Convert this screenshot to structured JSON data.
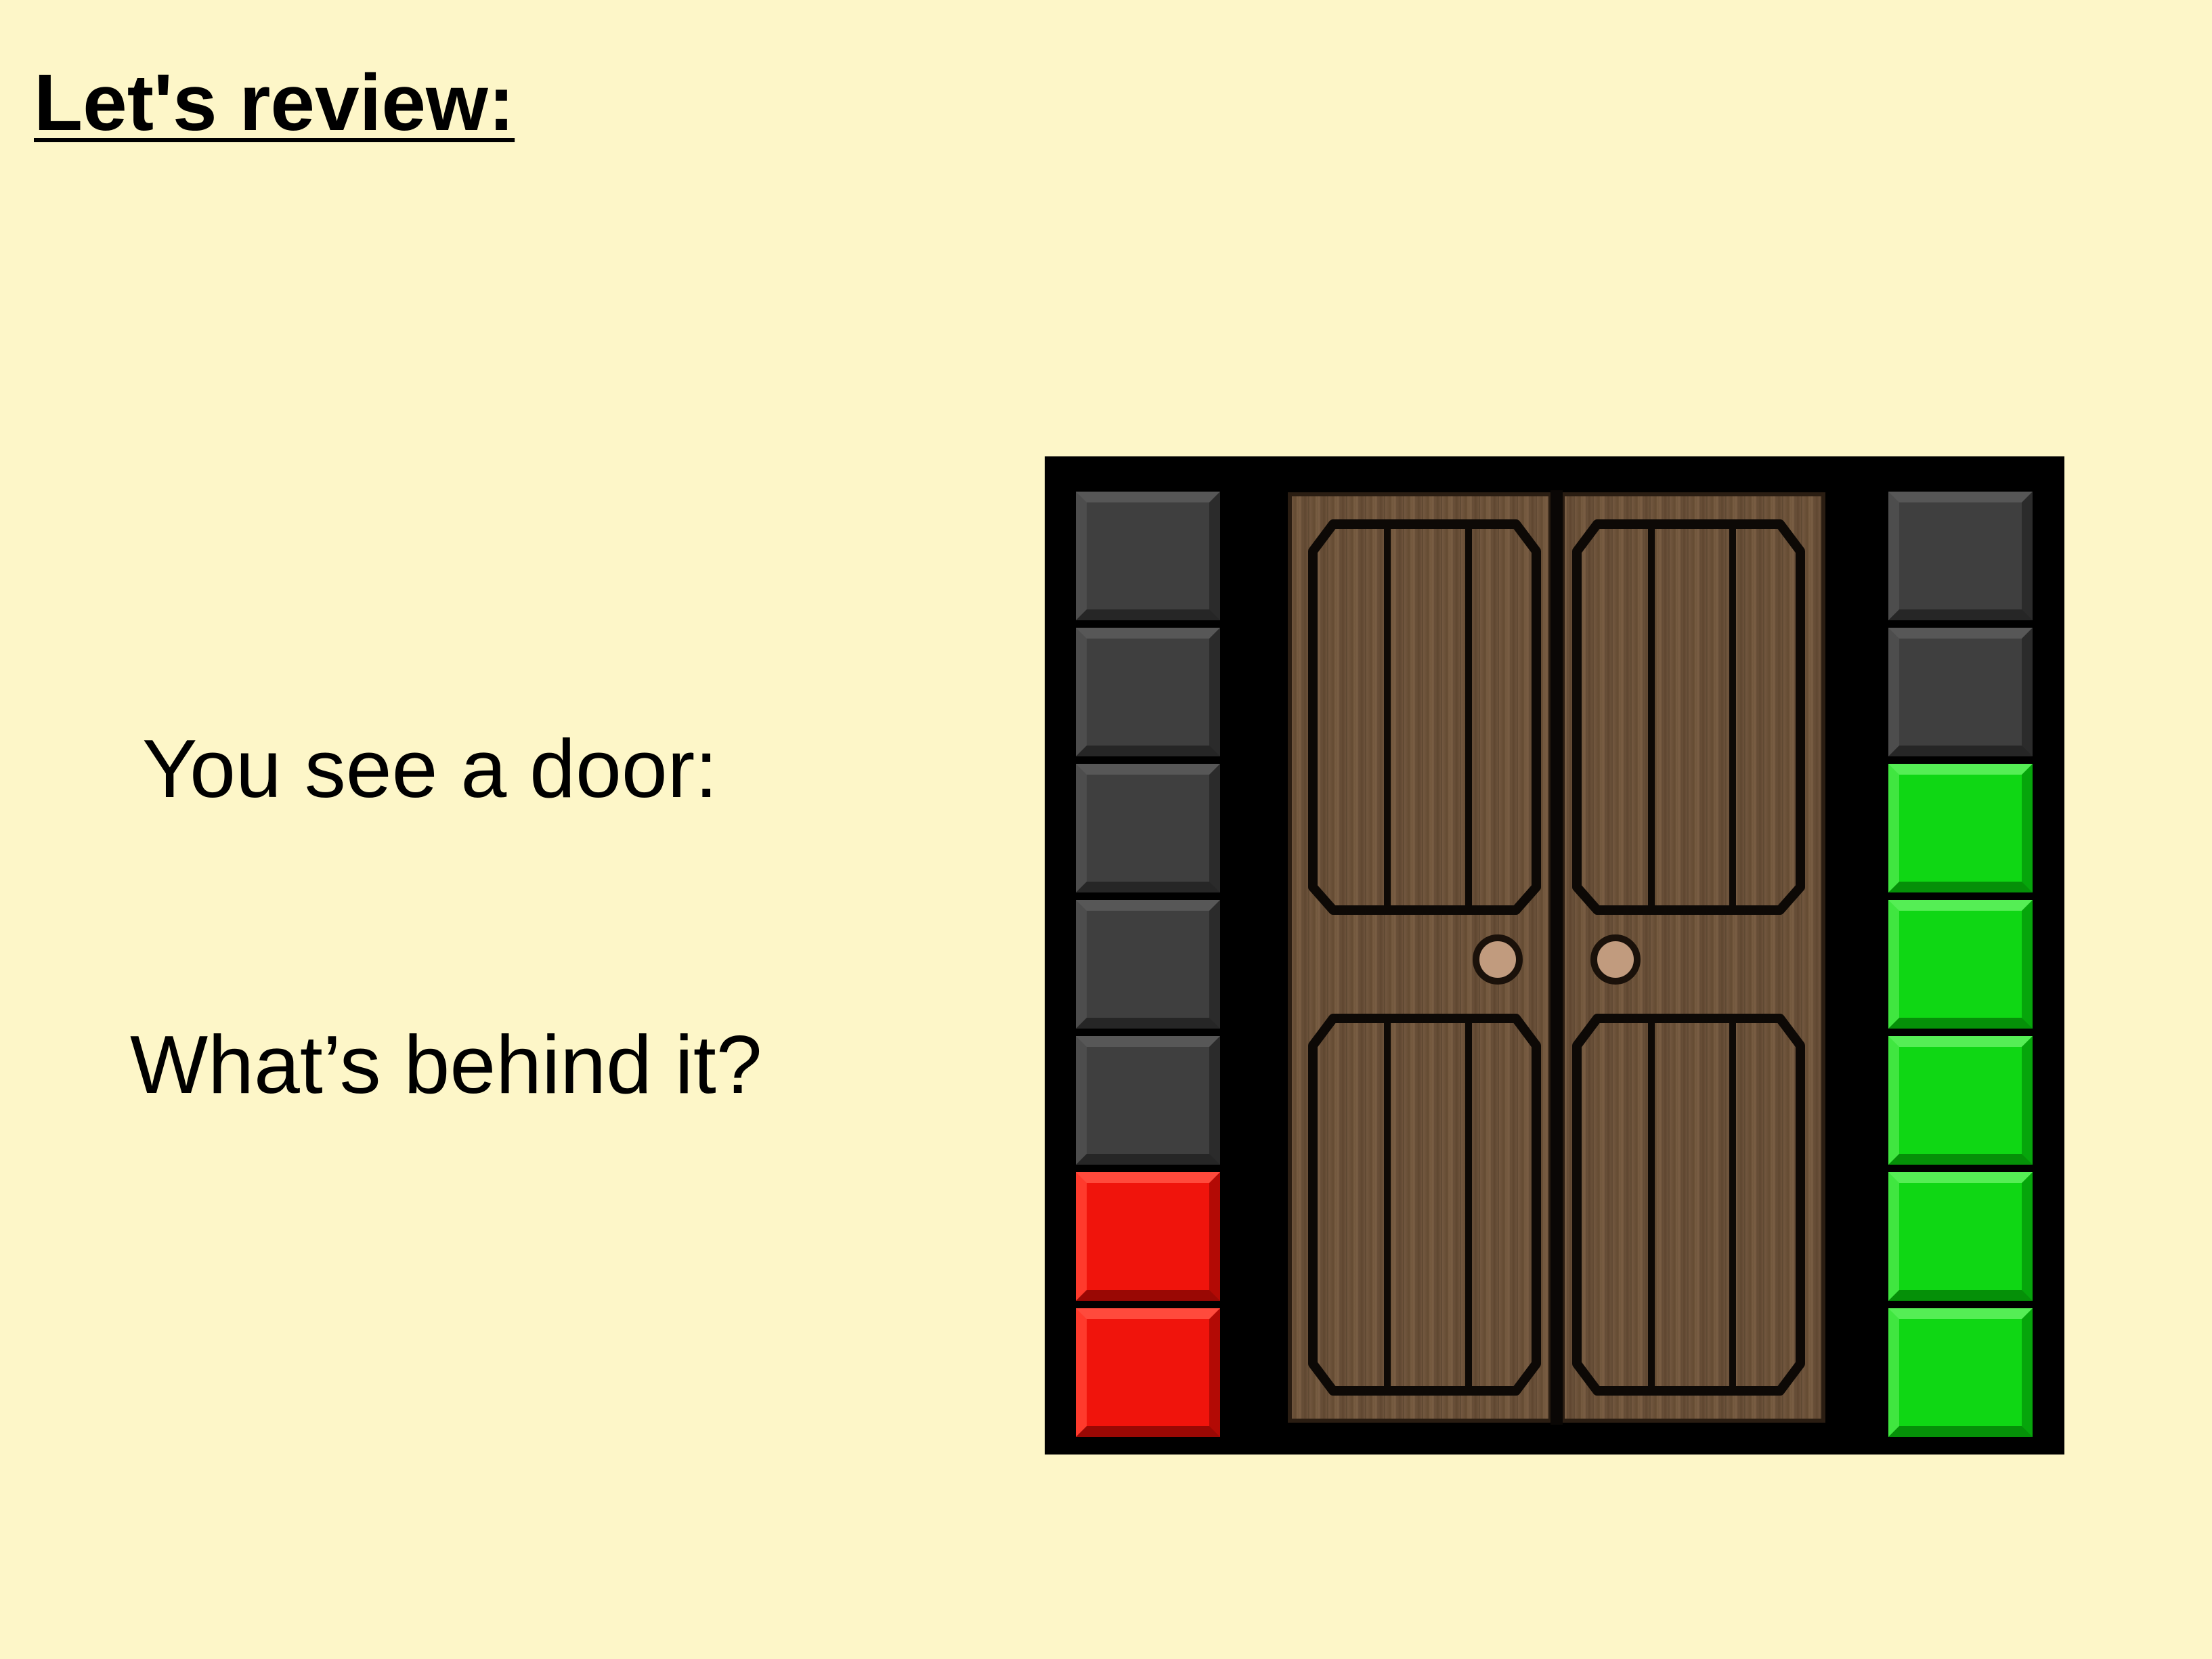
{
  "slide": {
    "title": "Let's review:",
    "line1": "You see a door:",
    "line2": "What’s behind it?"
  },
  "meters": {
    "left": [
      "gray",
      "gray",
      "gray",
      "gray",
      "gray",
      "red",
      "red"
    ],
    "right": [
      "gray",
      "gray",
      "green",
      "green",
      "green",
      "green",
      "green"
    ]
  },
  "colors": {
    "background": "#fdf6c8",
    "panel": "#000000",
    "gray_block": "#3f3f3f",
    "red_block": "#f0140c",
    "green_block": "#0fd714",
    "door_wood": "#6b5136",
    "knob": "#c19b7e"
  }
}
